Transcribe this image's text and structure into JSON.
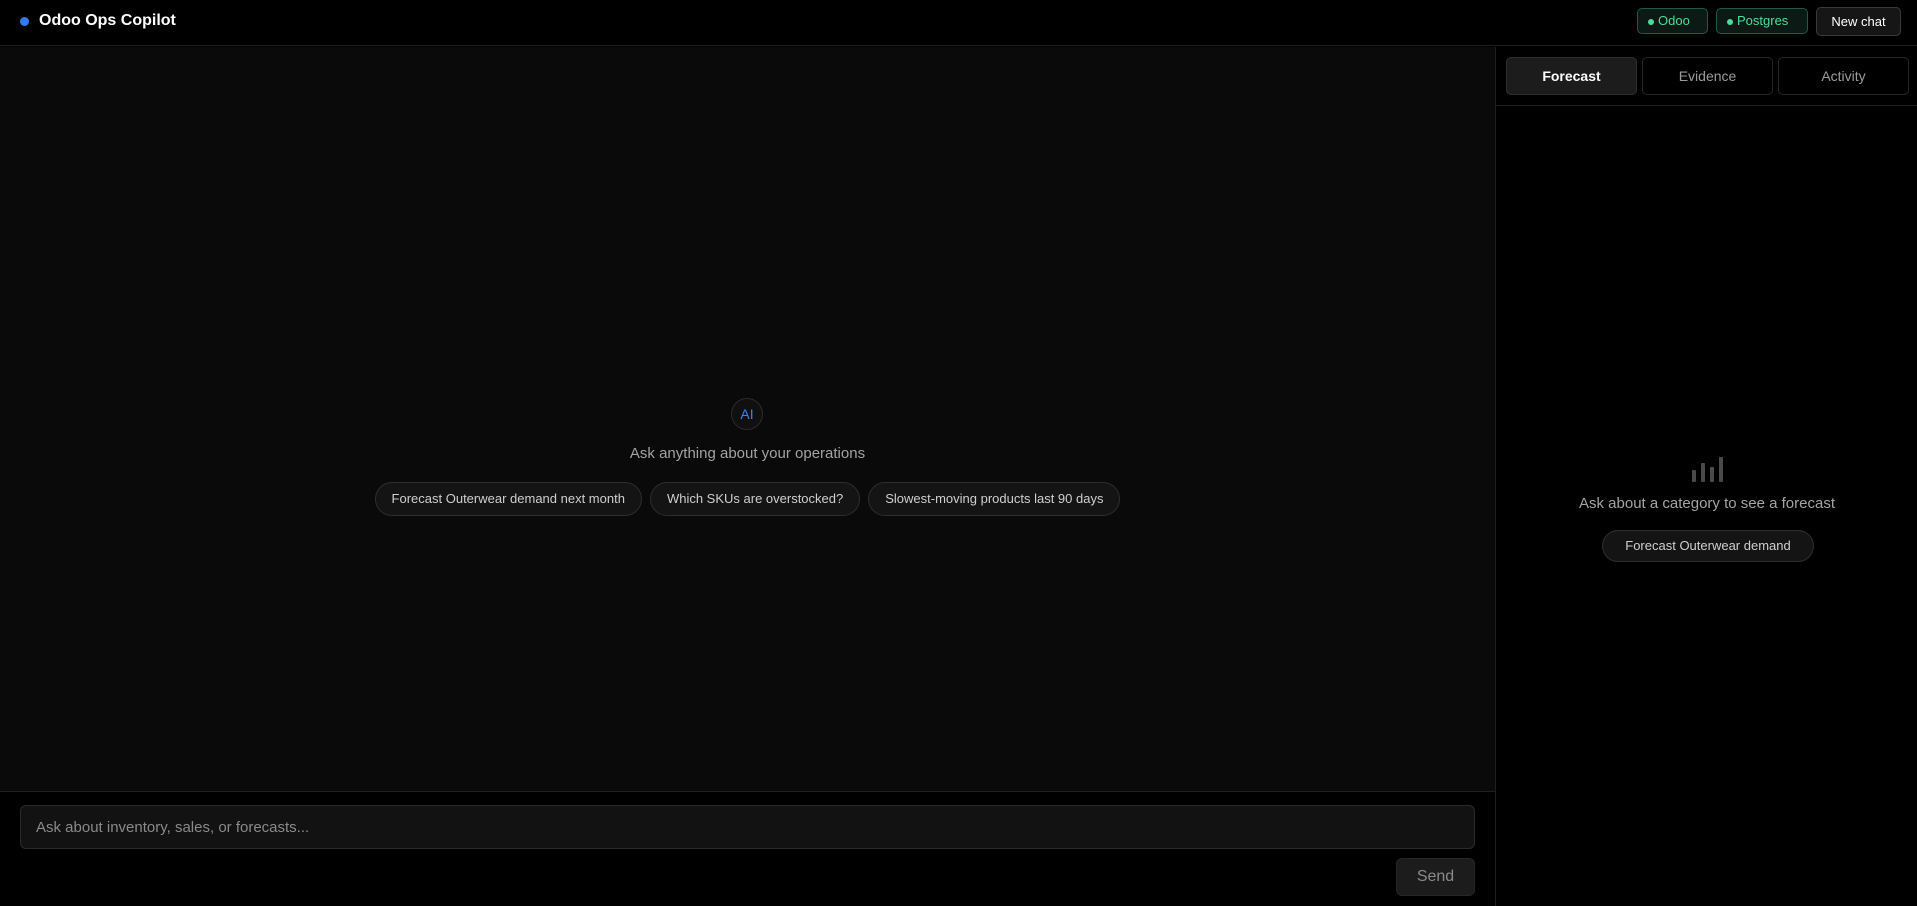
{
  "header": {
    "title": "Odoo Ops Copilot",
    "brand_color": "#2f7cf6",
    "status": [
      {
        "label": "Odoo",
        "state": "connected",
        "color": "#4ade9a"
      },
      {
        "label": "Postgres",
        "state": "connected",
        "color": "#4ade9a"
      }
    ],
    "new_chat_label": "New chat"
  },
  "chat": {
    "avatar_label": "AI",
    "welcome": "Ask anything about your operations",
    "suggestions": [
      "Forecast Outerwear demand next month",
      "Which SKUs are overstocked?",
      "Slowest-moving products last 90 days"
    ],
    "input_placeholder": "Ask about inventory, sales, or forecasts...",
    "send_label": "Send"
  },
  "side_panel": {
    "tabs": [
      {
        "label": "Forecast",
        "active": true
      },
      {
        "label": "Evidence",
        "active": false
      },
      {
        "label": "Activity",
        "active": false
      }
    ],
    "empty_icon": "bar-chart-icon",
    "empty_text": "Ask about a category to see a forecast",
    "suggestion": "Forecast Outerwear demand"
  }
}
